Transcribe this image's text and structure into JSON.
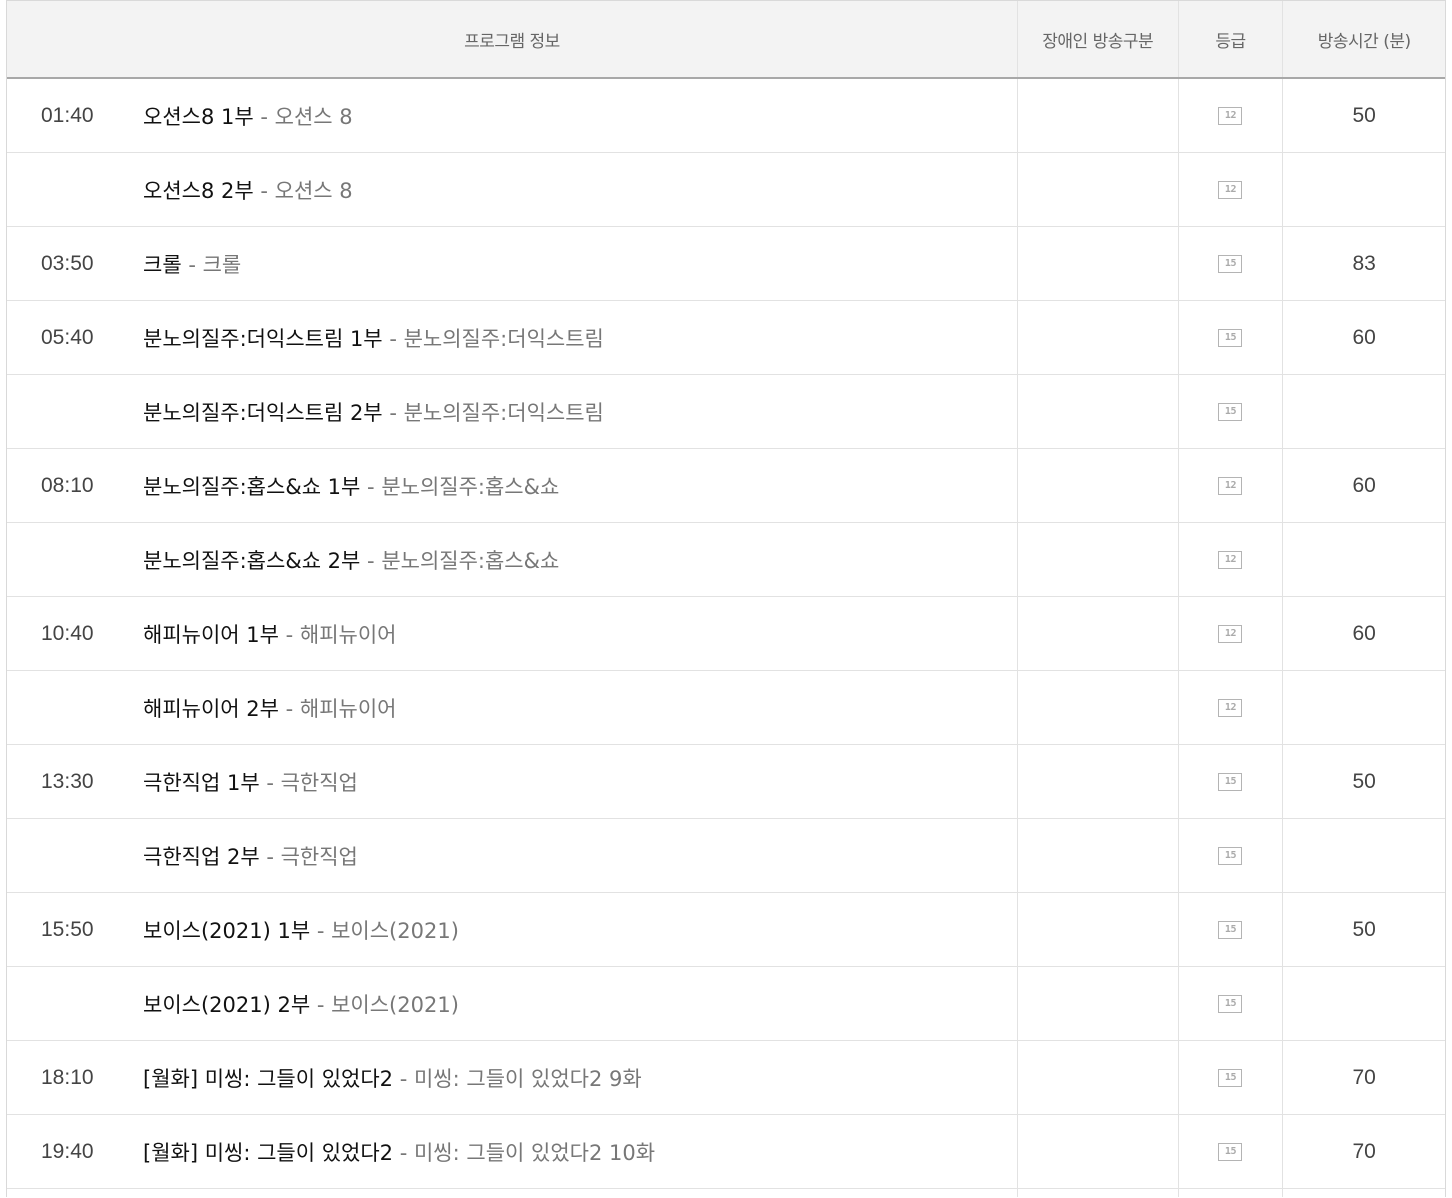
{
  "header": {
    "program_info": "프로그램 정보",
    "accessibility": "장애인 방송구분",
    "grade": "등급",
    "duration": "방송시간 (분)"
  },
  "rows": [
    {
      "time": "01:40",
      "title": "오션스8 1부",
      "separator": " - ",
      "subtitle": "오션스 8",
      "grade": "12",
      "duration": "50"
    },
    {
      "time": "",
      "title": "오션스8 2부",
      "separator": " - ",
      "subtitle": "오션스 8",
      "grade": "12",
      "duration": ""
    },
    {
      "time": "03:50",
      "title": "크롤",
      "separator": " - ",
      "subtitle": "크롤",
      "grade": "15",
      "duration": "83"
    },
    {
      "time": "05:40",
      "title": "분노의질주:더익스트림 1부",
      "separator": " - ",
      "subtitle": "분노의질주:더익스트림",
      "grade": "15",
      "duration": "60"
    },
    {
      "time": "",
      "title": "분노의질주:더익스트림 2부",
      "separator": " - ",
      "subtitle": "분노의질주:더익스트림",
      "grade": "15",
      "duration": ""
    },
    {
      "time": "08:10",
      "title": "분노의질주:홉스&쇼 1부",
      "separator": " - ",
      "subtitle": "분노의질주:홉스&쇼",
      "grade": "12",
      "duration": "60"
    },
    {
      "time": "",
      "title": "분노의질주:홉스&쇼 2부",
      "separator": " - ",
      "subtitle": "분노의질주:홉스&쇼",
      "grade": "12",
      "duration": ""
    },
    {
      "time": "10:40",
      "title": "해피뉴이어 1부",
      "separator": " - ",
      "subtitle": "해피뉴이어",
      "grade": "12",
      "duration": "60"
    },
    {
      "time": "",
      "title": "해피뉴이어 2부",
      "separator": " - ",
      "subtitle": "해피뉴이어",
      "grade": "12",
      "duration": ""
    },
    {
      "time": "13:30",
      "title": "극한직업 1부",
      "separator": " - ",
      "subtitle": "극한직업",
      "grade": "15",
      "duration": "50"
    },
    {
      "time": "",
      "title": "극한직업 2부",
      "separator": " - ",
      "subtitle": "극한직업",
      "grade": "15",
      "duration": ""
    },
    {
      "time": "15:50",
      "title": "보이스(2021) 1부",
      "separator": " - ",
      "subtitle": "보이스(2021)",
      "grade": "15",
      "duration": "50"
    },
    {
      "time": "",
      "title": "보이스(2021) 2부",
      "separator": " - ",
      "subtitle": "보이스(2021)",
      "grade": "15",
      "duration": ""
    },
    {
      "time": "18:10",
      "title": "[월화] 미씽: 그들이 있었다2",
      "separator": " - ",
      "subtitle": "미씽: 그들이 있었다2 9화",
      "grade": "15",
      "duration": "70"
    },
    {
      "time": "19:40",
      "title": "[월화] 미씽: 그들이 있었다2",
      "separator": " - ",
      "subtitle": "미씽: 그들이 있었다2 10화",
      "grade": "15",
      "duration": "70"
    }
  ]
}
